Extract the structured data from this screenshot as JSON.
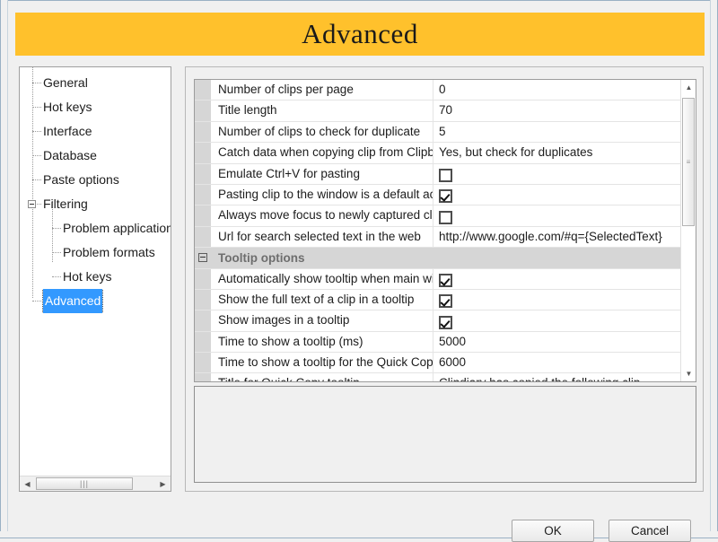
{
  "window": {
    "header_title": "Advanced",
    "header_color": "#ffc12c"
  },
  "tree": {
    "selected": "Advanced",
    "selection_color": "#3399ff",
    "items": [
      {
        "label": "General",
        "level": 1,
        "selected": false
      },
      {
        "label": "Hot keys",
        "level": 1,
        "selected": false
      },
      {
        "label": "Interface",
        "level": 1,
        "selected": false
      },
      {
        "label": "Database",
        "level": 1,
        "selected": false
      },
      {
        "label": "Paste options",
        "level": 1,
        "selected": false
      },
      {
        "label": "Filtering",
        "level": 1,
        "selected": false,
        "expander": "minus"
      },
      {
        "label": "Problem application",
        "level": 2,
        "selected": false
      },
      {
        "label": "Problem formats",
        "level": 2,
        "selected": false
      },
      {
        "label": "Hot keys",
        "level": 2,
        "selected": false
      },
      {
        "label": "Advanced",
        "level": 1,
        "selected": true
      }
    ],
    "hscrollbar": {
      "left_arrow": "◀",
      "right_arrow": "▶",
      "grip": "|||"
    }
  },
  "grid": {
    "rows": [
      {
        "kind": "property",
        "name": "Number of clips per page",
        "value": "0",
        "type": "text"
      },
      {
        "kind": "property",
        "name": "Title length",
        "value": "70",
        "type": "text"
      },
      {
        "kind": "property",
        "name": "Number of clips to check for duplicate",
        "value": "5",
        "type": "text"
      },
      {
        "kind": "property",
        "name": "Catch data when copying clip from Clipboard",
        "value": "Yes, but check for duplicates",
        "type": "text"
      },
      {
        "kind": "property",
        "name": "Emulate Ctrl+V for pasting",
        "value": "",
        "type": "checkbox",
        "checked": false
      },
      {
        "kind": "property",
        "name": "Pasting clip to the window is a default action",
        "value": "",
        "type": "checkbox",
        "checked": true
      },
      {
        "kind": "property",
        "name": "Always move focus to newly captured clip",
        "value": "",
        "type": "checkbox",
        "checked": false
      },
      {
        "kind": "property",
        "name": "Url for search selected text in the web",
        "value": "http://www.google.com/#q={SelectedText}",
        "type": "text"
      },
      {
        "kind": "category",
        "name": "Tooltip options"
      },
      {
        "kind": "property",
        "name": "Automatically show tooltip when main window",
        "value": "",
        "type": "checkbox",
        "checked": true
      },
      {
        "kind": "property",
        "name": "Show the full text of a clip in a tooltip",
        "value": "",
        "type": "checkbox",
        "checked": true
      },
      {
        "kind": "property",
        "name": "Show images in a tooltip",
        "value": "",
        "type": "checkbox",
        "checked": true
      },
      {
        "kind": "property",
        "name": "Time to show a tooltip (ms)",
        "value": "5000",
        "type": "text"
      },
      {
        "kind": "property",
        "name": "Time to show a tooltip for the Quick Copy",
        "value": "6000",
        "type": "text"
      },
      {
        "kind": "property",
        "name": "Title for Quick Copy tooltip",
        "value": "Clindiary has copied the following clip",
        "type": "text"
      }
    ],
    "vscrollbar": {
      "up_arrow": "▲",
      "down_arrow": "▼",
      "grip": "≡"
    }
  },
  "description_panel": {
    "text": ""
  },
  "buttons": {
    "ok_label": "OK",
    "cancel_label": "Cancel"
  }
}
